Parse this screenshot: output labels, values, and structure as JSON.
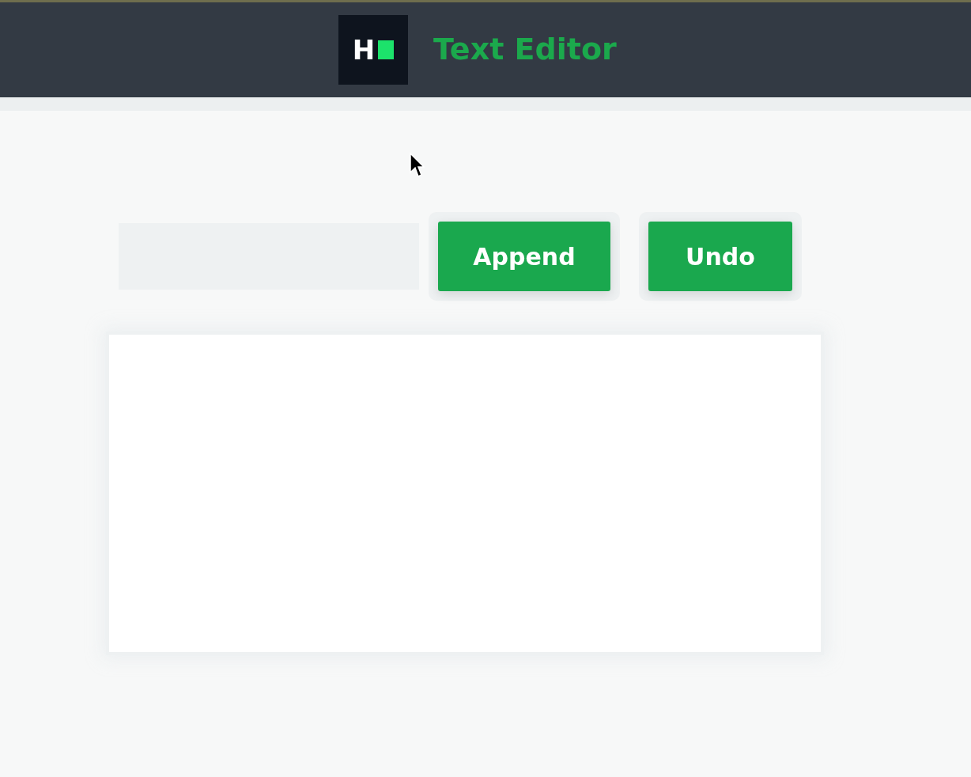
{
  "header": {
    "logo_letter": "H",
    "title": "Text Editor"
  },
  "buttons": [
    {
      "label": "Append"
    },
    {
      "label": "Undo"
    }
  ]
}
